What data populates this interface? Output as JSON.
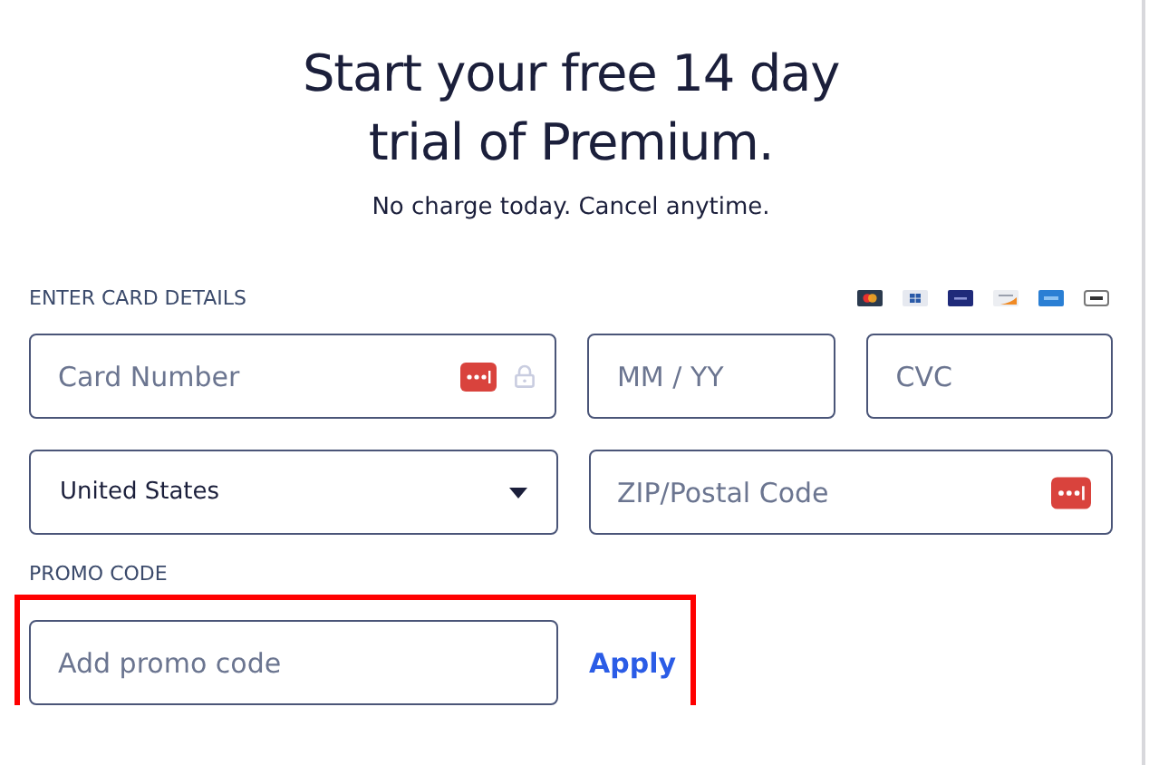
{
  "title": "Start your free 14 day trial of Premium.",
  "subtitle": "No charge today. Cancel anytime.",
  "card_section": {
    "label": "ENTER CARD DETAILS"
  },
  "card_fields": [
    {
      "kind": "card",
      "placeholder": "Card Number"
    },
    {
      "kind": "plain",
      "placeholder": "MM / YY"
    },
    {
      "kind": "plain",
      "placeholder": "CVC"
    }
  ],
  "country_select": {
    "value": "United States"
  },
  "zip_field": {
    "placeholder": "ZIP/Postal Code"
  },
  "promo": {
    "label": "PROMO CODE",
    "placeholder": "Add promo code",
    "button": "Apply",
    "highlighted": true
  }
}
